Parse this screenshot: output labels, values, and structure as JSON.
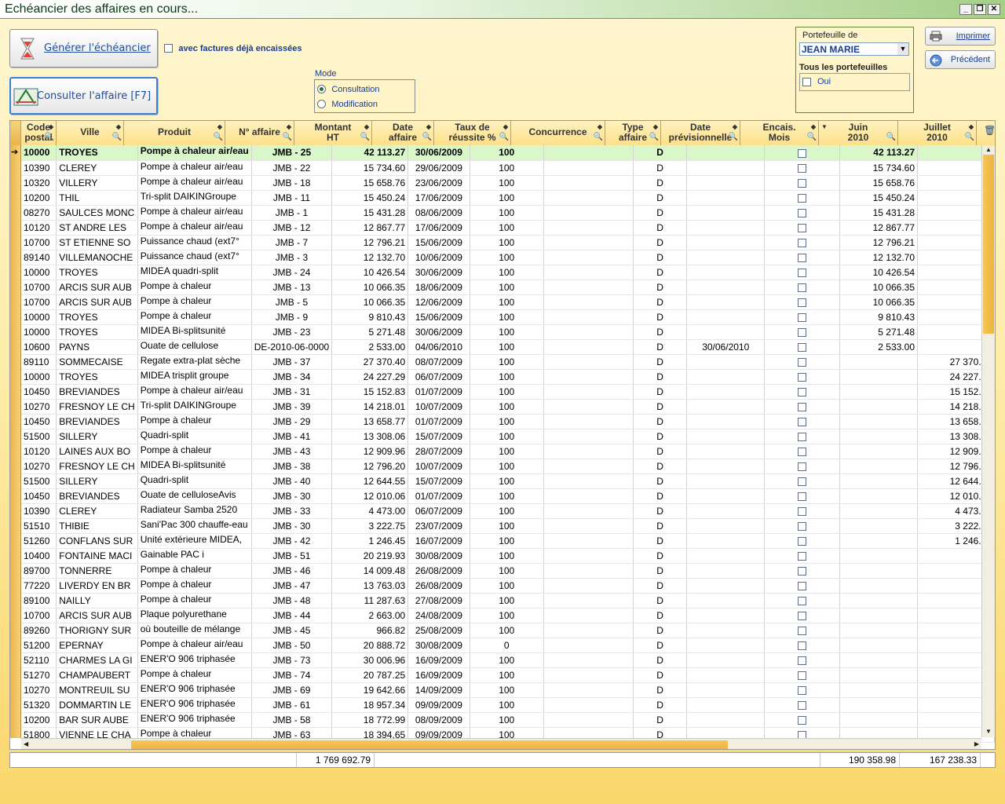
{
  "window": {
    "title": "Echéancier des affaires en cours...",
    "btn_min": "_",
    "btn_restore": "❐",
    "btn_close": "✕"
  },
  "toolbar": {
    "generate_label": "Générer l'échéancier",
    "include_paid_label": "avec factures déjà encaissées",
    "consult_label": "Consulter l'affaire [F7]",
    "print_label": "Imprimer",
    "previous_label": "Précédent"
  },
  "mode": {
    "title": "Mode",
    "options": [
      "Consultation",
      "Modification"
    ],
    "selected": "Consultation"
  },
  "portfolio": {
    "title": "Portefeuille de",
    "value": "JEAN MARIE",
    "all_label": "Tous les portefeuilles",
    "yes_label": "Oui"
  },
  "columns": [
    {
      "l1": "Code",
      "l2": "postal"
    },
    {
      "l1": "Ville",
      "l2": ""
    },
    {
      "l1": "Produit",
      "l2": ""
    },
    {
      "l1": "N° affaire",
      "l2": ""
    },
    {
      "l1": "Montant",
      "l2": "HT"
    },
    {
      "l1": "Date",
      "l2": "affaire"
    },
    {
      "l1": "Taux de",
      "l2": "réussite %"
    },
    {
      "l1": "Concurrence",
      "l2": ""
    },
    {
      "l1": "Type",
      "l2": "affaire"
    },
    {
      "l1": "Date",
      "l2": "prévisionnelle"
    },
    {
      "l1": "Encais.",
      "l2": "Mois"
    },
    {
      "l1": "Juin",
      "l2": "2010"
    },
    {
      "l1": "Juillet",
      "l2": "2010"
    }
  ],
  "rows": [
    [
      "10000",
      "TROYES",
      "Pompe à chaleur air/eau",
      "JMB - 25",
      "42 113.27",
      "30/06/2009",
      "100",
      "",
      "D",
      "",
      "",
      "42 113.27",
      ""
    ],
    [
      "10390",
      "CLEREY",
      "Pompe à chaleur air/eau",
      "JMB - 22",
      "15 734.60",
      "29/06/2009",
      "100",
      "",
      "D",
      "",
      "",
      "15 734.60",
      ""
    ],
    [
      "10320",
      "VILLERY",
      "Pompe à chaleur air/eau",
      "JMB - 18",
      "15 658.76",
      "23/06/2009",
      "100",
      "",
      "D",
      "",
      "",
      "15 658.76",
      ""
    ],
    [
      "10200",
      "THIL",
      "Tri-split DAIKINGroupe",
      "JMB - 11",
      "15 450.24",
      "17/06/2009",
      "100",
      "",
      "D",
      "",
      "",
      "15 450.24",
      ""
    ],
    [
      "08270",
      "SAULCES MONC",
      "Pompe à chaleur air/eau",
      "JMB - 1",
      "15 431.28",
      "08/06/2009",
      "100",
      "",
      "D",
      "",
      "",
      "15 431.28",
      ""
    ],
    [
      "10120",
      "ST ANDRE LES",
      "Pompe à chaleur air/eau",
      "JMB - 12",
      "12 867.77",
      "17/06/2009",
      "100",
      "",
      "D",
      "",
      "",
      "12 867.77",
      ""
    ],
    [
      "10700",
      "ST ETIENNE SO",
      "Puissance chaud (ext7°",
      "JMB - 7",
      "12 796.21",
      "15/06/2009",
      "100",
      "",
      "D",
      "",
      "",
      "12 796.21",
      ""
    ],
    [
      "89140",
      "VILLEMANOCHE",
      "Puissance chaud (ext7°",
      "JMB - 3",
      "12 132.70",
      "10/06/2009",
      "100",
      "",
      "D",
      "",
      "",
      "12 132.70",
      ""
    ],
    [
      "10000",
      "TROYES",
      "MIDEA quadri-split",
      "JMB - 24",
      "10 426.54",
      "30/06/2009",
      "100",
      "",
      "D",
      "",
      "",
      "10 426.54",
      ""
    ],
    [
      "10700",
      "ARCIS SUR AUB",
      "Pompe à chaleur",
      "JMB - 13",
      "10 066.35",
      "18/06/2009",
      "100",
      "",
      "D",
      "",
      "",
      "10 066.35",
      ""
    ],
    [
      "10700",
      "ARCIS SUR AUB",
      "Pompe à chaleur",
      "JMB - 5",
      "10 066.35",
      "12/06/2009",
      "100",
      "",
      "D",
      "",
      "",
      "10 066.35",
      ""
    ],
    [
      "10000",
      "TROYES",
      "Pompe à chaleur",
      "JMB - 9",
      "9 810.43",
      "15/06/2009",
      "100",
      "",
      "D",
      "",
      "",
      "9 810.43",
      ""
    ],
    [
      "10000",
      "TROYES",
      "MIDEA Bi-splitsunité",
      "JMB - 23",
      "5 271.48",
      "30/06/2009",
      "100",
      "",
      "D",
      "",
      "",
      "5 271.48",
      ""
    ],
    [
      "10600",
      "PAYNS",
      "Ouate de cellulose",
      "DE-2010-06-0000",
      "2 533.00",
      "04/06/2010",
      "100",
      "",
      "D",
      "30/06/2010",
      "",
      "2 533.00",
      ""
    ],
    [
      "89110",
      "SOMMECAISE",
      "Regate extra-plat sèche",
      "JMB - 37",
      "27 370.40",
      "08/07/2009",
      "100",
      "",
      "D",
      "",
      "",
      "",
      "27 370.40"
    ],
    [
      "10000",
      "TROYES",
      "MIDEA trisplit groupe",
      "JMB - 34",
      "24 227.29",
      "06/07/2009",
      "100",
      "",
      "D",
      "",
      "",
      "",
      "24 227.29"
    ],
    [
      "10450",
      "BREVIANDES",
      "Pompe à chaleur air/eau",
      "JMB - 31",
      "15 152.83",
      "01/07/2009",
      "100",
      "",
      "D",
      "",
      "",
      "",
      "15 152.83"
    ],
    [
      "10270",
      "FRESNOY LE CH",
      "Tri-split DAIKINGroupe",
      "JMB - 39",
      "14 218.01",
      "10/07/2009",
      "100",
      "",
      "D",
      "",
      "",
      "",
      "14 218.01"
    ],
    [
      "10450",
      "BREVIANDES",
      "Pompe à chaleur",
      "JMB - 29",
      "13 658.77",
      "01/07/2009",
      "100",
      "",
      "D",
      "",
      "",
      "",
      "13 658.77"
    ],
    [
      "51500",
      "SILLERY",
      "Quadri-split",
      "JMB - 41",
      "13 308.06",
      "15/07/2009",
      "100",
      "",
      "D",
      "",
      "",
      "",
      "13 308.06"
    ],
    [
      "10120",
      "LAINES AUX BO",
      "Pompe à chaleur",
      "JMB - 43",
      "12 909.96",
      "28/07/2009",
      "100",
      "",
      "D",
      "",
      "",
      "",
      "12 909.96"
    ],
    [
      "10270",
      "FRESNOY LE CH",
      "MIDEA Bi-splitsunité",
      "JMB - 38",
      "12 796.20",
      "10/07/2009",
      "100",
      "",
      "D",
      "",
      "",
      "",
      "12 796.20"
    ],
    [
      "51500",
      "SILLERY",
      "Quadri-split",
      "JMB - 40",
      "12 644.55",
      "15/07/2009",
      "100",
      "",
      "D",
      "",
      "",
      "",
      "12 644.55"
    ],
    [
      "10450",
      "BREVIANDES",
      "Ouate de celluloseAvis",
      "JMB - 30",
      "12 010.06",
      "01/07/2009",
      "100",
      "",
      "D",
      "",
      "",
      "",
      "12 010.06"
    ],
    [
      "10390",
      "CLEREY",
      "Radiateur Samba 2520",
      "JMB - 33",
      "4 473.00",
      "06/07/2009",
      "100",
      "",
      "D",
      "",
      "",
      "",
      "4 473.00"
    ],
    [
      "51510",
      "THIBIE",
      "Sani'Pac 300 chauffe-eau",
      "JMB - 30",
      "3 222.75",
      "23/07/2009",
      "100",
      "",
      "D",
      "",
      "",
      "",
      "3 222.75"
    ],
    [
      "51260",
      "CONFLANS SUR",
      "Unité extérieure MIDEA,",
      "JMB - 42",
      "1 246.45",
      "16/07/2009",
      "100",
      "",
      "D",
      "",
      "",
      "",
      "1 246.45"
    ],
    [
      "10400",
      "FONTAINE MACI",
      "Gainable PAC  i",
      "JMB - 51",
      "20 219.93",
      "30/08/2009",
      "100",
      "",
      "D",
      "",
      "",
      "",
      ""
    ],
    [
      "89700",
      "TONNERRE",
      "Pompe à chaleur",
      "JMB - 46",
      "14 009.48",
      "26/08/2009",
      "100",
      "",
      "D",
      "",
      "",
      "",
      ""
    ],
    [
      "77220",
      "LIVERDY EN BR",
      "Pompe à chaleur",
      "JMB - 47",
      "13 763.03",
      "26/08/2009",
      "100",
      "",
      "D",
      "",
      "",
      "",
      ""
    ],
    [
      "89100",
      "NAILLY",
      "Pompe à chaleur",
      "JMB - 48",
      "11 287.63",
      "27/08/2009",
      "100",
      "",
      "D",
      "",
      "",
      "",
      ""
    ],
    [
      "10700",
      "ARCIS SUR AUB",
      "Plaque polyurethane",
      "JMB - 44",
      "2 663.00",
      "24/08/2009",
      "100",
      "",
      "D",
      "",
      "",
      "",
      ""
    ],
    [
      "89260",
      "THORIGNY SUR",
      "où bouteille de mélange",
      "JMB - 45",
      "966.82",
      "25/08/2009",
      "100",
      "",
      "D",
      "",
      "",
      "",
      ""
    ],
    [
      "51200",
      "EPERNAY",
      "Pompe à chaleur air/eau",
      "JMB - 50",
      "20 888.72",
      "30/08/2009",
      "0",
      "",
      "D",
      "",
      "",
      "",
      ""
    ],
    [
      "52110",
      "CHARMES LA GI",
      "ENER'O 906 triphasée",
      "JMB - 73",
      "30 006.96",
      "16/09/2009",
      "100",
      "",
      "D",
      "",
      "",
      "",
      ""
    ],
    [
      "51270",
      "CHAMPAUBERT",
      "Pompe à chaleur",
      "JMB - 74",
      "20 787.25",
      "16/09/2009",
      "100",
      "",
      "D",
      "",
      "",
      "",
      ""
    ],
    [
      "10270",
      "MONTREUIL SU",
      "ENER'O 906 triphasée",
      "JMB - 69",
      "19 642.66",
      "14/09/2009",
      "100",
      "",
      "D",
      "",
      "",
      "",
      ""
    ],
    [
      "51320",
      "DOMMARTIN LE",
      "ENER'O 906 triphasée",
      "JMB - 61",
      "18 957.34",
      "09/09/2009",
      "100",
      "",
      "D",
      "",
      "",
      "",
      ""
    ],
    [
      "10200",
      "BAR SUR AUBE",
      "ENER'O 906 triphasée",
      "JMB - 58",
      "18 772.99",
      "08/09/2009",
      "100",
      "",
      "D",
      "",
      "",
      "",
      ""
    ],
    [
      "51800",
      "VIENNE LE CHA",
      "Pompe à chaleur",
      "JMB - 63",
      "18 394.65",
      "09/09/2009",
      "100",
      "",
      "D",
      "",
      "",
      "",
      ""
    ]
  ],
  "totals": {
    "montant": "1 769 692.79",
    "juin": "190 358.98",
    "juillet": "167 238.33"
  },
  "icons": {
    "filter": "magnifier-icon",
    "sort": "sort-arrow-icon",
    "trash": "trash-icon",
    "current_row": "current-row-arrow-icon"
  }
}
